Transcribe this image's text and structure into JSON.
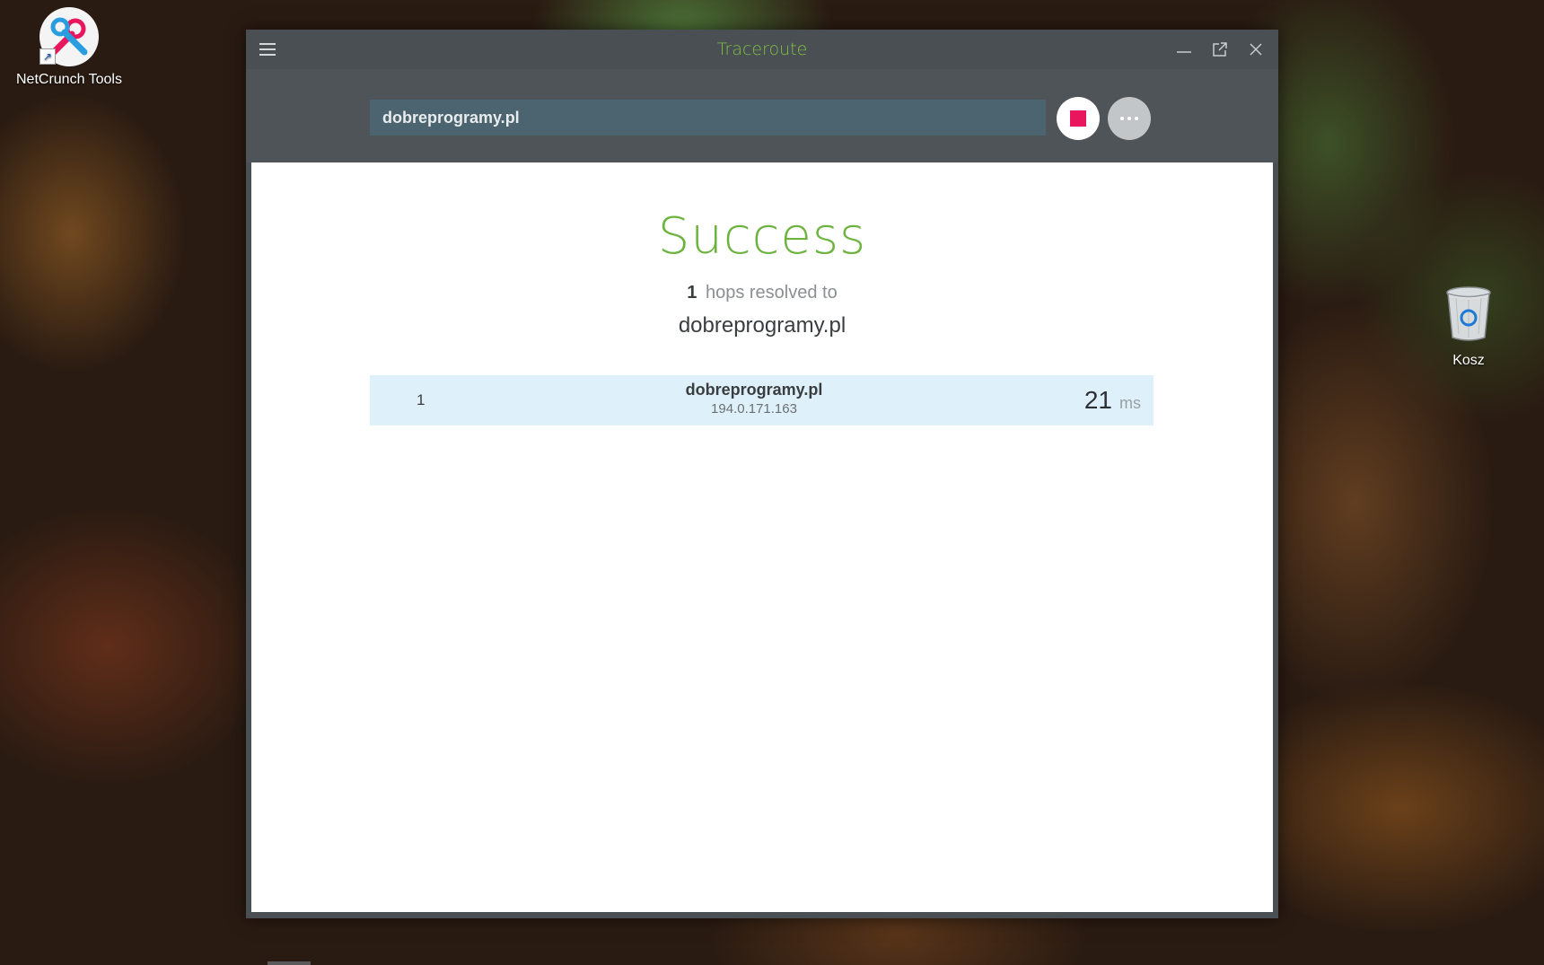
{
  "desktop": {
    "icons": [
      {
        "label": "NetCrunch Tools",
        "icon": "netcrunch-tools-icon"
      },
      {
        "label": "Kosz",
        "icon": "recycle-bin-icon"
      }
    ]
  },
  "window": {
    "title": "Traceroute",
    "title_color": "#7fc144",
    "controls": [
      "hamburger-menu-icon",
      "minimize-icon",
      "popout-icon",
      "close-icon"
    ]
  },
  "toolbar": {
    "host_value": "dobreprogramy.pl",
    "stop_color": "#e8175d"
  },
  "result": {
    "status": "Success",
    "status_color": "#6db33f",
    "hops_count": "1",
    "hops_text": "hops resolved to",
    "target": "dobreprogramy.pl",
    "hops": [
      {
        "number": "1",
        "host": "dobreprogramy.pl",
        "ip": "194.0.171.163",
        "time": "21",
        "unit": "ms"
      }
    ]
  }
}
